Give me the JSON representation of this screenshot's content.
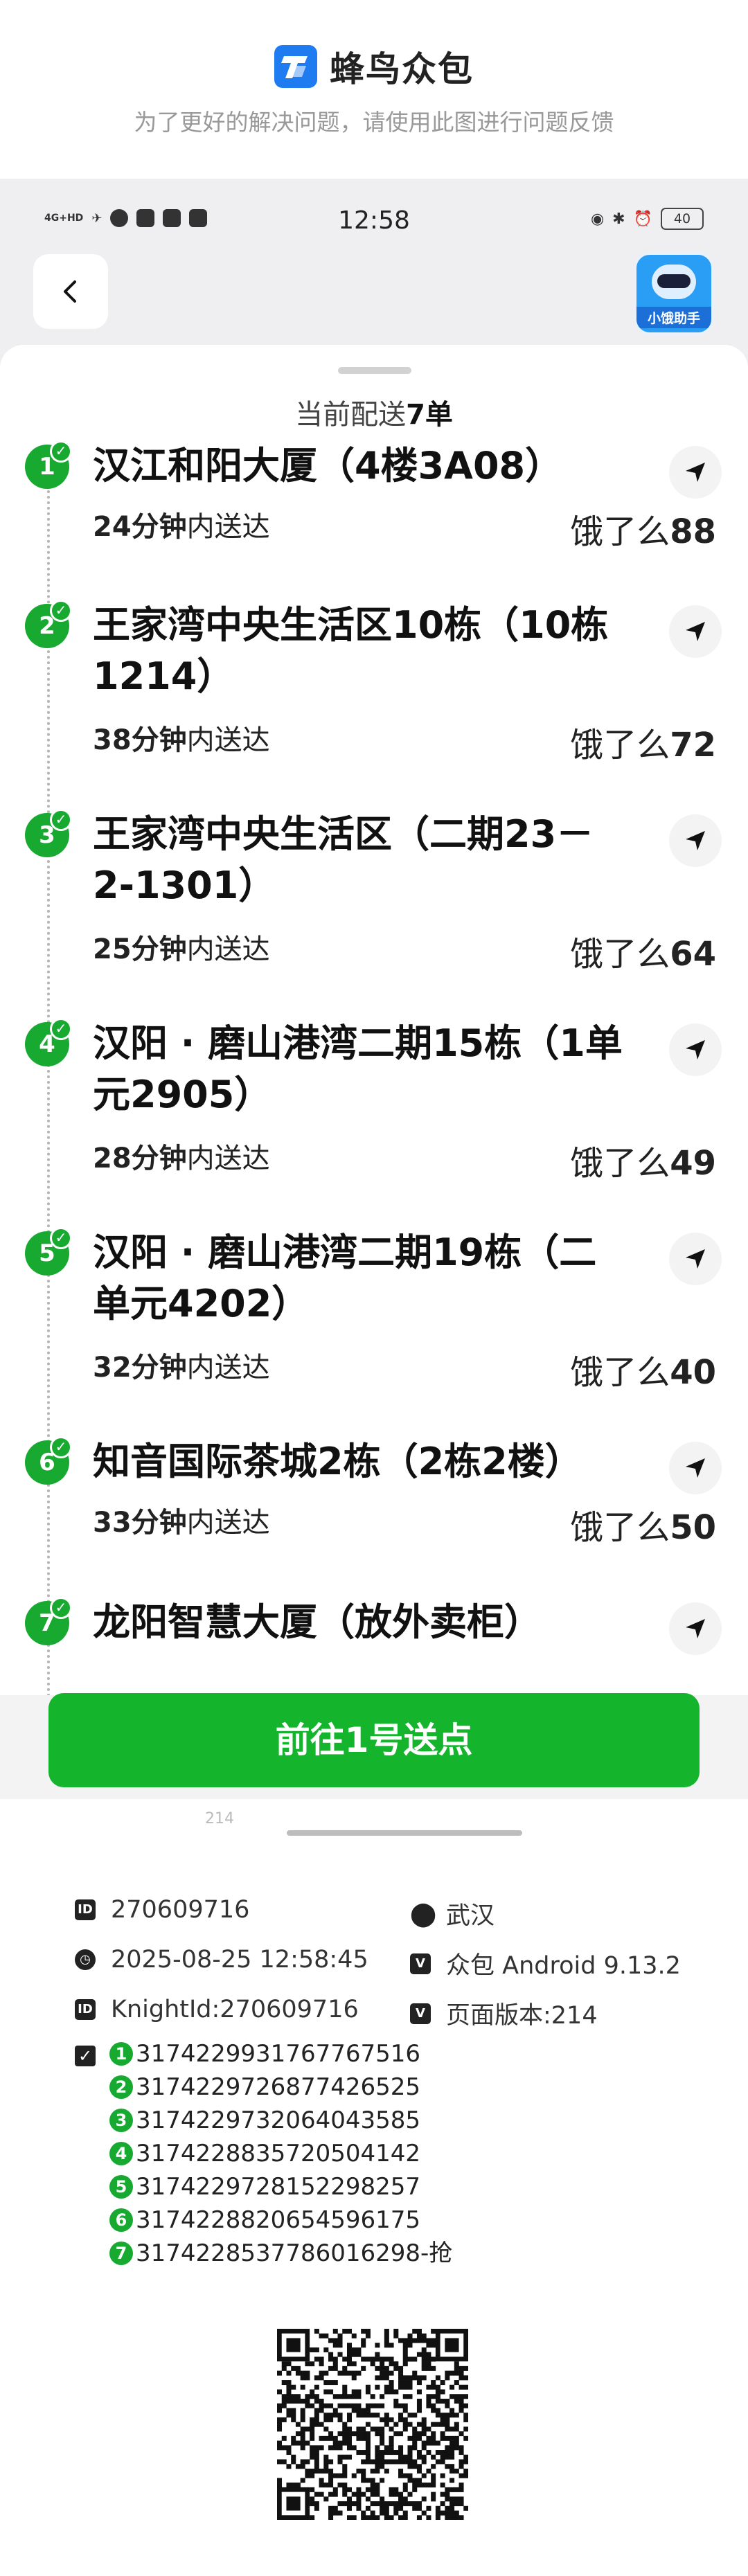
{
  "banner": {
    "app_name": "蜂鸟众包",
    "subtitle": "为了更好的解决问题，请使用此图进行问题反馈"
  },
  "status_bar": {
    "network": "4G+HD",
    "time": "12:58",
    "battery": "40"
  },
  "nav": {
    "helper_label": "小饿助手"
  },
  "sheet": {
    "title_prefix": "当前配送",
    "title_count": "7单",
    "orders": [
      {
        "num": "1",
        "address": "汉江和阳大厦（4楼3A08）",
        "eta_value": "24分钟",
        "eta_suffix": "内送达",
        "shop_prefix": "饿了么",
        "shop_num": "88"
      },
      {
        "num": "2",
        "address": "王家湾中央生活区10栋（10栋1214）",
        "eta_value": "38分钟",
        "eta_suffix": "内送达",
        "shop_prefix": "饿了么",
        "shop_num": "72"
      },
      {
        "num": "3",
        "address": "王家湾中央生活区（二期23－2-1301）",
        "eta_value": "25分钟",
        "eta_suffix": "内送达",
        "shop_prefix": "饿了么",
        "shop_num": "64"
      },
      {
        "num": "4",
        "address": "汉阳 · 磨山港湾二期15栋（1单元2905）",
        "eta_value": "28分钟",
        "eta_suffix": "内送达",
        "shop_prefix": "饿了么",
        "shop_num": "49"
      },
      {
        "num": "5",
        "address": "汉阳 · 磨山港湾二期19栋（二单元4202）",
        "eta_value": "32分钟",
        "eta_suffix": "内送达",
        "shop_prefix": "饿了么",
        "shop_num": "40"
      },
      {
        "num": "6",
        "address": "知音国际茶城2栋（2栋2楼）",
        "eta_value": "33分钟",
        "eta_suffix": "内送达",
        "shop_prefix": "饿了么",
        "shop_num": "50"
      },
      {
        "num": "7",
        "address": "龙阳智慧大厦（放外卖柜）",
        "eta_value": "",
        "eta_suffix": "",
        "shop_prefix": "",
        "shop_num": ""
      }
    ],
    "action_label": "前往1号送点",
    "version_hint": "214"
  },
  "info": {
    "id": "270609716",
    "city": "武汉",
    "datetime": "2025-08-25 12:58:45",
    "client": "众包 Android 9.13.2",
    "knight_id": "KnightId:270609716",
    "page_version": "页面版本:214",
    "order_ids": [
      {
        "num": "1",
        "code": "3174229931767767516"
      },
      {
        "num": "2",
        "code": "3174229726877426525"
      },
      {
        "num": "3",
        "code": "3174229732064043585"
      },
      {
        "num": "4",
        "code": "3174228835720504142"
      },
      {
        "num": "5",
        "code": "3174229728152298257"
      },
      {
        "num": "6",
        "code": "3174228820654596175"
      },
      {
        "num": "7",
        "code": "3174228537786016298-抢"
      }
    ]
  },
  "colors": {
    "accent_green": "#14b52c",
    "brand_blue": "#1e7bf0"
  }
}
